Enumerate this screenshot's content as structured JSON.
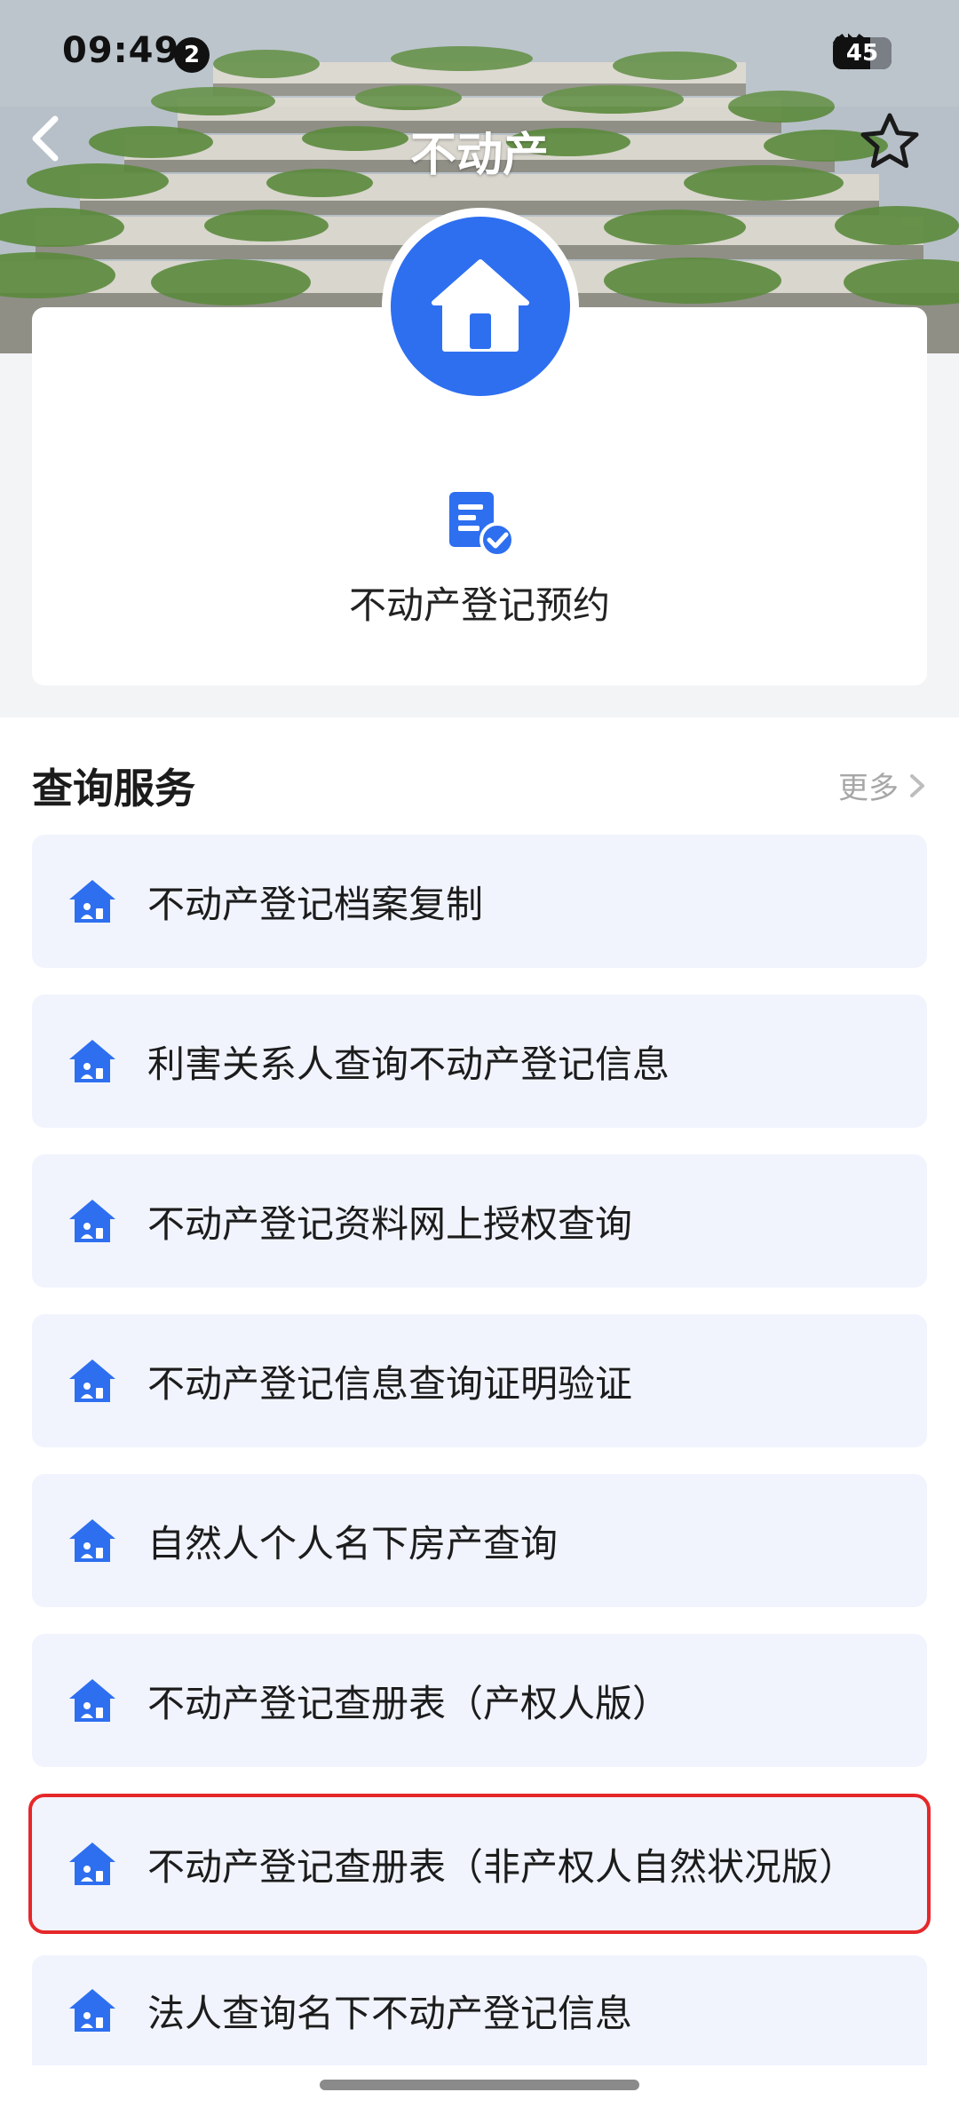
{
  "status_bar": {
    "time": "09:49",
    "notification_count": "2",
    "battery_level": "45",
    "icons": [
      "alarm-icon",
      "mute-icon",
      "bluetooth-icon",
      "signal-4g-icon",
      "signal-4g-icon-2",
      "battery-icon"
    ]
  },
  "header": {
    "title": "不动产",
    "back_icon": "chevron-left-icon",
    "favorite_icon": "star-outline-icon"
  },
  "top_card": {
    "main_icon": "house-icon",
    "booking_icon": "document-check-icon",
    "booking_label": "不动产登记预约"
  },
  "query_section": {
    "title": "查询服务",
    "more_label": "更多",
    "items": [
      {
        "label": "不动产登记档案复制",
        "highlighted": false
      },
      {
        "label": "利害关系人查询不动产登记信息",
        "highlighted": false
      },
      {
        "label": "不动产登记资料网上授权查询",
        "highlighted": false
      },
      {
        "label": "不动产登记信息查询证明验证",
        "highlighted": false
      },
      {
        "label": "自然人个人名下房产查询",
        "highlighted": false
      },
      {
        "label": "不动产登记查册表（产权人版）",
        "highlighted": false
      },
      {
        "label": "不动产登记查册表（非产权人自然状况版）",
        "highlighted": true
      },
      {
        "label": "法人查询名下不动产登记信息",
        "highlighted": false
      }
    ]
  },
  "colors": {
    "accent": "#2e6ff0",
    "item_background": "#f1f4fd",
    "highlight_border": "#e5282a",
    "muted_text": "#a7a7a7"
  }
}
